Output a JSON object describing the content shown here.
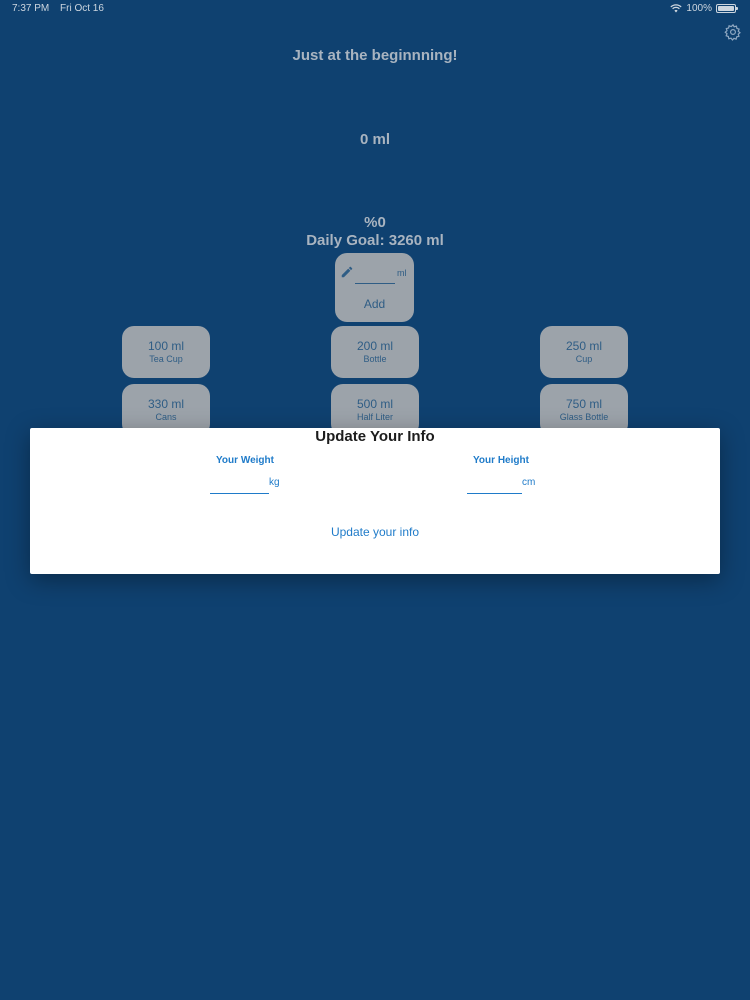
{
  "status_bar": {
    "time": "7:37 PM",
    "date": "Fri Oct 16",
    "battery": "100%"
  },
  "header": {
    "title": "Just at the beginnning!",
    "settings_icon": "gear-icon"
  },
  "progress": {
    "amount": "0 ml",
    "percent": "%0",
    "daily_goal": "Daily Goal: 3260 ml"
  },
  "custom_entry": {
    "unit": "ml",
    "add_label": "Add",
    "icon": "pencil-icon"
  },
  "presets": [
    {
      "amount": "100 ml",
      "name": "Tea Cup"
    },
    {
      "amount": "200 ml",
      "name": "Bottle"
    },
    {
      "amount": "250 ml",
      "name": "Cup"
    },
    {
      "amount": "330 ml",
      "name": "Cans"
    },
    {
      "amount": "500 ml",
      "name": "Half Liter"
    },
    {
      "amount": "750 ml",
      "name": "Glass Bottle"
    }
  ],
  "dialog": {
    "title": "Update Your Info",
    "weight_label": "Your Weight",
    "weight_unit": "kg",
    "height_label": "Your Height",
    "height_unit": "cm",
    "update_label": "Update your info"
  },
  "colors": {
    "background": "#0f4170",
    "card": "#9ca3aa",
    "accent": "#1f7bc9"
  }
}
